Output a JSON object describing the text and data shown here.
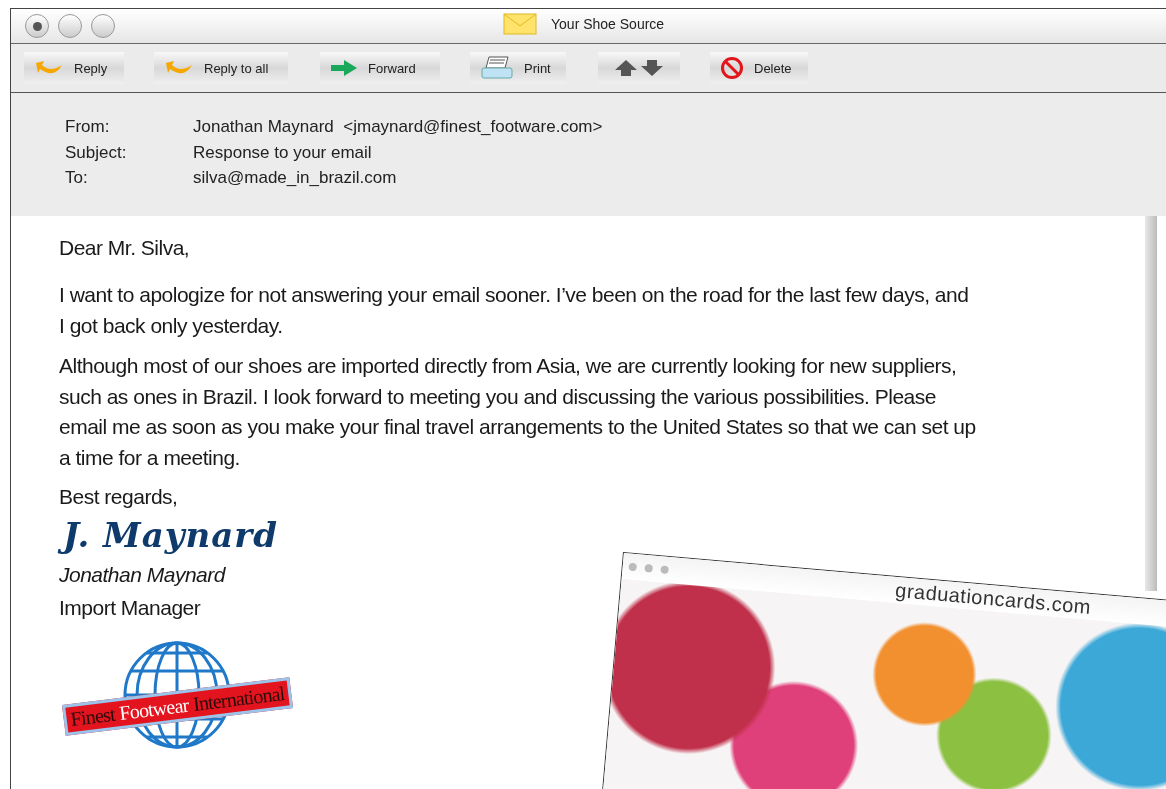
{
  "window": {
    "title": "Your Shoe Source",
    "controls": [
      {
        "marked": true
      },
      {
        "marked": false
      },
      {
        "marked": false
      }
    ]
  },
  "toolbar": [
    {
      "kind": "reply",
      "label": "Reply"
    },
    {
      "kind": "reply_all",
      "label": "Reply to all"
    },
    {
      "kind": "forward",
      "label": "Forward"
    },
    {
      "kind": "print",
      "label": "Print"
    },
    {
      "kind": "arrows"
    },
    {
      "kind": "delete",
      "label": "Delete"
    }
  ],
  "header": [
    {
      "label": "From:",
      "value": "Jonathan Maynard  <jmaynard@finest_footware.com>"
    },
    {
      "label": "Subject:",
      "value": "Response to your email"
    },
    {
      "label": "To:",
      "value": "silva@made_in_brazil.com"
    }
  ],
  "body": {
    "greeting": "Dear Mr. Silva,",
    "paragraphs": [
      "I want to apologize for not answering your email sooner. I’ve been on the road for the last few days, and I got back only yesterday.",
      "Although most of our shoes are imported directly from Asia, we are currently looking for new suppliers, such as ones in Brazil. I look forward to meeting you and discussing the various possibilities. Please email me as soon as you make your final travel arrangements to the United States so that we can set up a time for a meeting."
    ],
    "closing": "Best regards,",
    "signature": "J. Maynard",
    "name": "Jonathan Maynard",
    "role": "Import Manager",
    "logo": [
      {
        "text": "Finest",
        "highlight": false
      },
      {
        "text": "Footwear",
        "highlight": true
      },
      {
        "text": "International",
        "highlight": false
      }
    ]
  },
  "overlay_window": {
    "address": "graduationcards.com"
  }
}
